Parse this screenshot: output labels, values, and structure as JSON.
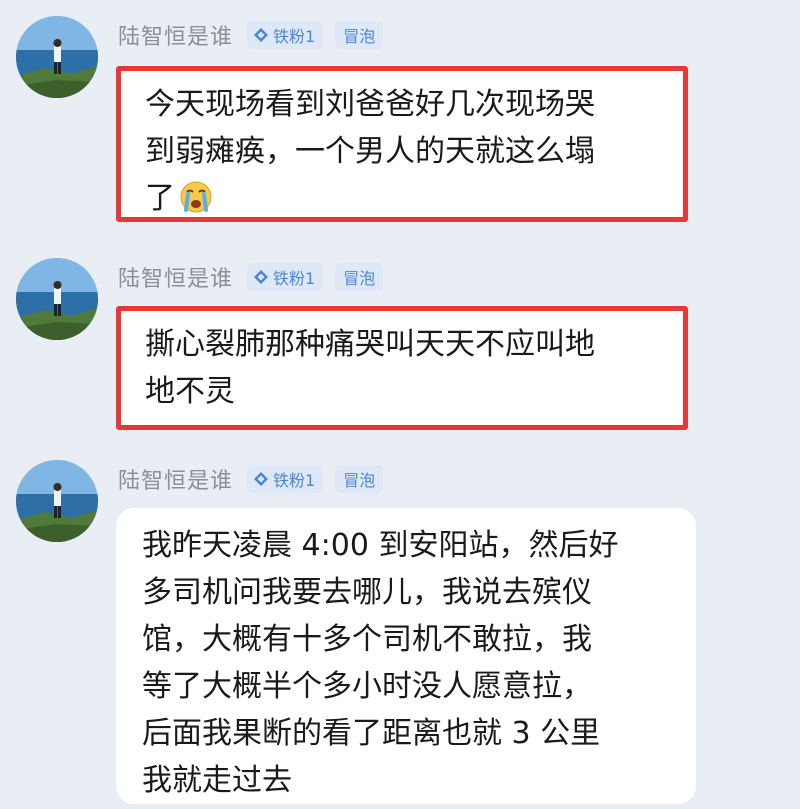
{
  "messages": [
    {
      "username": "陆智恒是谁",
      "fan_badge": "铁粉1",
      "bubble_badge": "冒泡",
      "text": "今天现场看到刘爸爸好几次现场哭\n到弱瘫痪，一个男人的天就这么塌\n了",
      "emoji": "crying-face-icon",
      "highlighted": true
    },
    {
      "username": "陆智恒是谁",
      "fan_badge": "铁粉1",
      "bubble_badge": "冒泡",
      "text": "撕心裂肺那种痛哭叫天天不应叫地\n地不灵",
      "highlighted": true
    },
    {
      "username": "陆智恒是谁",
      "fan_badge": "铁粉1",
      "bubble_badge": "冒泡",
      "text": "我昨天凌晨 4:00 到安阳站，然后好\n多司机问我要去哪儿，我说去殡仪\n馆，大概有十多个司机不敢拉，我\n等了大概半个多小时没人愿意拉，\n后面我果断的看了距离也就 3 公里\n我就走过去",
      "highlighted": false
    }
  ],
  "colors": {
    "background": "#e9eef5",
    "highlight_border": "#e53935",
    "badge_text": "#4a86d6"
  }
}
